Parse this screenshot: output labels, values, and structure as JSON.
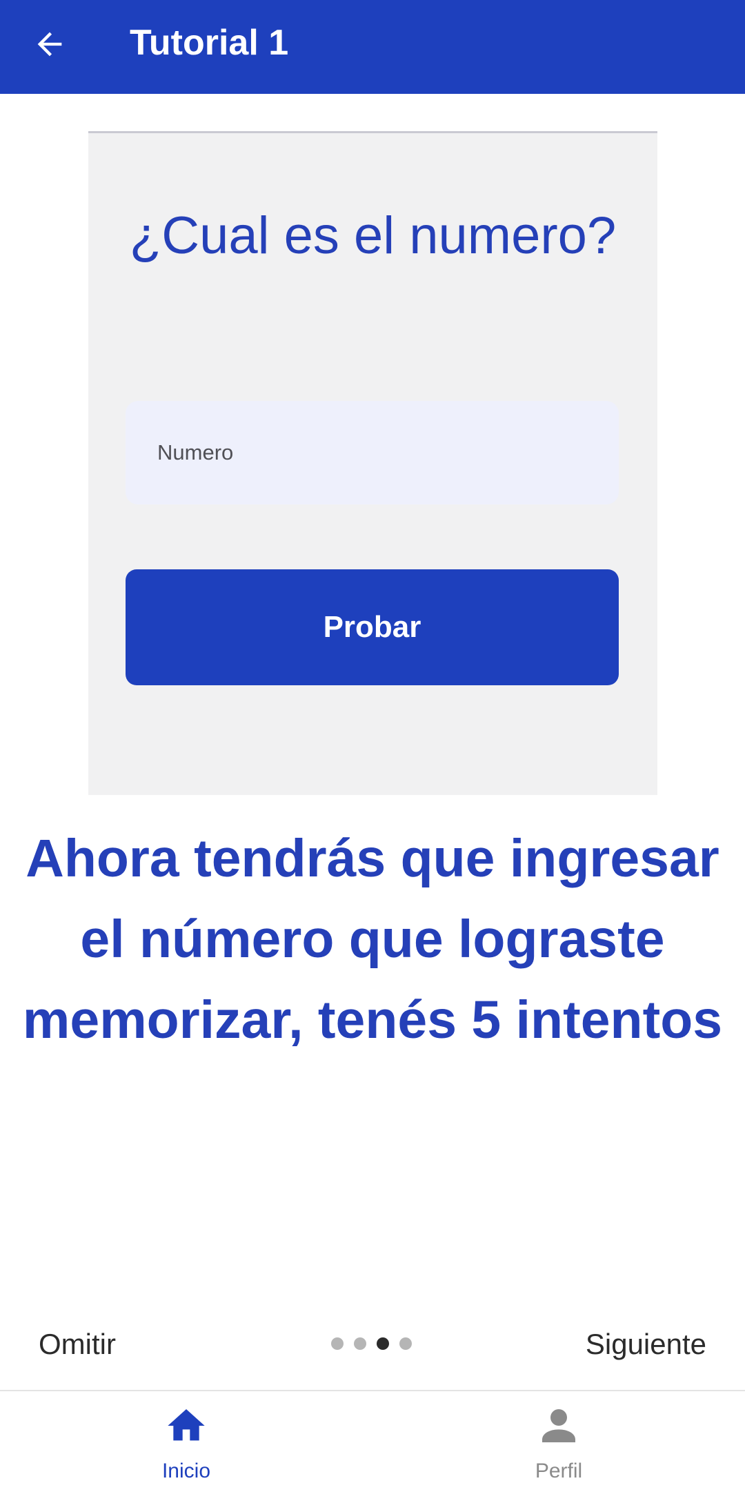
{
  "app_bar": {
    "title": "Tutorial 1",
    "back_icon": "arrow-left-icon",
    "color": "#1e40bd"
  },
  "illustration": {
    "question": "¿Cual es el numero?",
    "input_placeholder": "Numero",
    "button_label": "Probar"
  },
  "instruction": "Ahora tendrás que ingresar el número que lograste memorizar, tenés 5 intentos",
  "pager": {
    "skip_label": "Omitir",
    "next_label": "Siguiente",
    "page_count": 4,
    "current_page": 3
  },
  "bottom_nav": {
    "items": [
      {
        "label": "Inicio",
        "icon": "home-icon",
        "active": true
      },
      {
        "label": "Perfil",
        "icon": "person-icon",
        "active": false
      }
    ],
    "active_color": "#1e40bd",
    "inactive_color": "#8a8a8a"
  }
}
